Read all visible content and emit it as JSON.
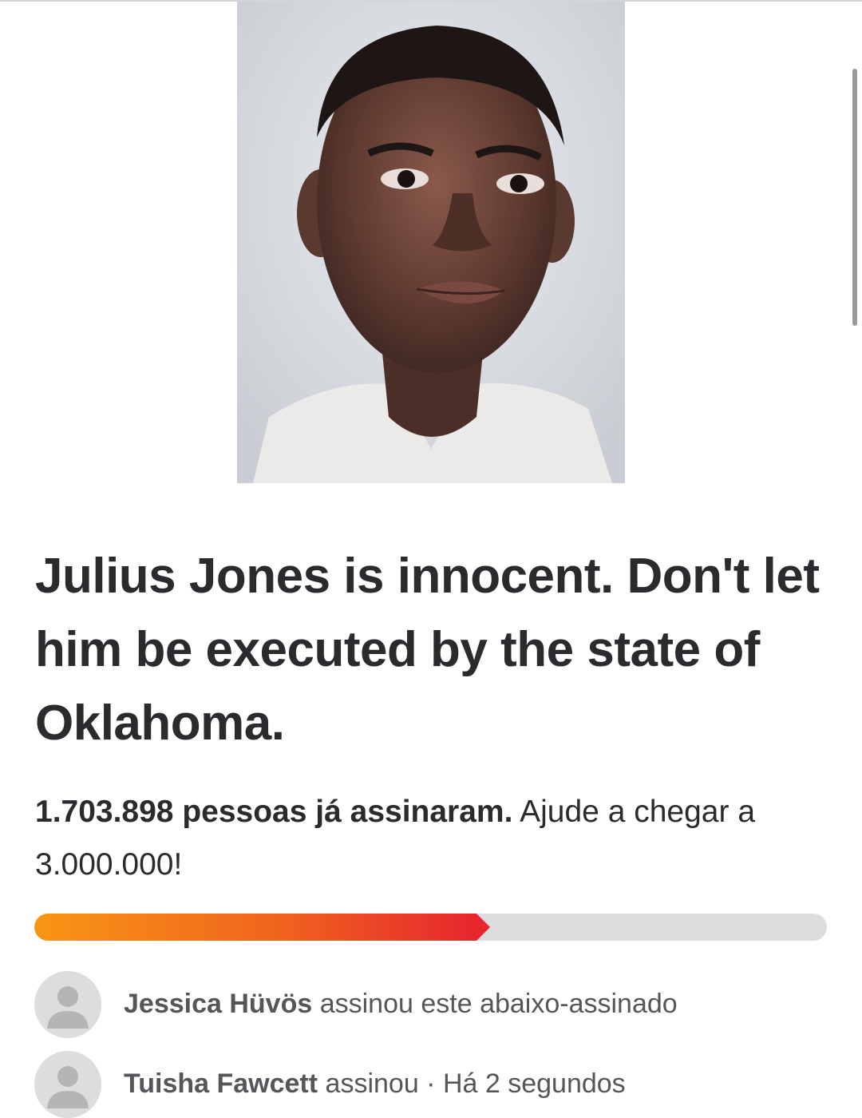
{
  "petition": {
    "title": "Julius Jones is innocent. Don't let him be executed by the state of Oklahoma.",
    "signed_count": "1.703.898 pessoas já assinaram.",
    "goal_text": "Ajude a chegar a 3.000.000!",
    "progress_fraction": 0.568
  },
  "signers": [
    {
      "name": "Jessica Hüvös",
      "action": "assinou este abaixo-assinado"
    },
    {
      "name": "Tuisha Fawcett",
      "action": "assinou · Há 2 segundos"
    }
  ],
  "colors": {
    "text": "#2b2a2e",
    "muted": "#56555a",
    "progress_start": "#f89614",
    "progress_end": "#e7262e",
    "track": "#dedcdf",
    "avatar": "#dddcde"
  },
  "icons": {
    "avatar": "user-silhouette-icon"
  }
}
